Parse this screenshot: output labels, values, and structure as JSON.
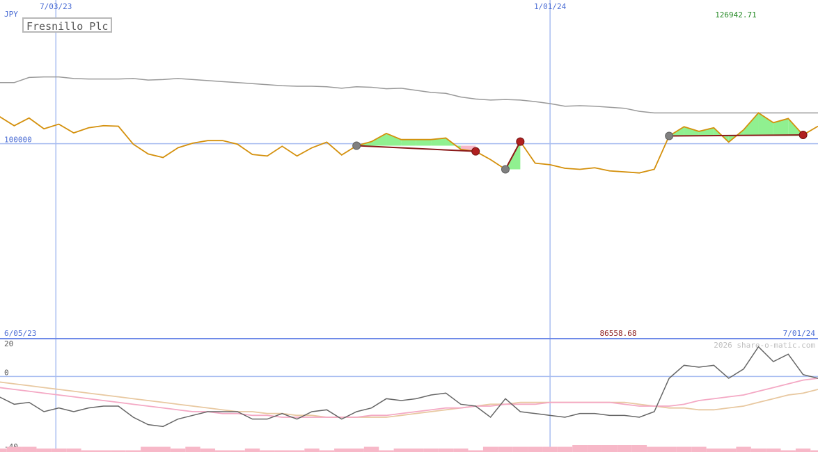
{
  "chart_data": [
    {
      "type": "line",
      "title": "Fresnillo Plc",
      "ylabel": "JPY",
      "x_date_labels": [
        "7/03/23",
        "1/01/24"
      ],
      "date_range": [
        "6/05/23",
        "7/01/24"
      ],
      "max_label": "126942.71",
      "min_label": "86558.68",
      "reference_line": 100000,
      "reference_label": "100000",
      "ylim": [
        62000,
        128000
      ],
      "grid": "vertical month lines",
      "n_points": 56,
      "series": [
        {
          "role": "price",
          "values": [
            105300,
            103500,
            105000,
            102900,
            103800,
            102100,
            103100,
            103500,
            103400,
            99900,
            98000,
            97300,
            99200,
            100100,
            100600,
            100600,
            99900,
            97900,
            97600,
            99500,
            97600,
            99200,
            100300,
            97800,
            99600,
            100400,
            102000,
            100800,
            100800,
            100800,
            101100,
            98900,
            98500,
            96900,
            95000,
            100400,
            96200,
            95900,
            95200,
            95000,
            95300,
            94700,
            94500,
            94300,
            95000,
            101500,
            103300,
            102400,
            103100,
            100300,
            102700,
            106000,
            104100,
            104900,
            101700,
            103400
          ]
        },
        {
          "role": "moving average",
          "values": [
            111900,
            111900,
            112900,
            113000,
            113000,
            112700,
            112600,
            112600,
            112600,
            112700,
            112400,
            112500,
            112700,
            112500,
            112300,
            112100,
            111900,
            111700,
            111500,
            111300,
            111200,
            111200,
            111100,
            110800,
            111100,
            111000,
            110700,
            110800,
            110400,
            110000,
            109800,
            109100,
            108700,
            108500,
            108600,
            108500,
            108200,
            107800,
            107300,
            107400,
            107300,
            107100,
            106900,
            106300,
            106000,
            106000,
            106000,
            106000,
            106000,
            106000,
            106000,
            106000,
            106000,
            106000,
            106000,
            106000
          ]
        }
      ],
      "trades": [
        {
          "start": 24,
          "end": 32,
          "outcome": "loss"
        },
        {
          "start": 34,
          "end": 35,
          "outcome": "loss"
        },
        {
          "start": 45,
          "end": 54,
          "outcome": "loss"
        }
      ]
    },
    {
      "type": "line",
      "title": "",
      "credit": "2026 share-o-matic.com",
      "ylim": [
        -40,
        20
      ],
      "y_ticks": [
        20,
        0,
        -40
      ],
      "tick_labels": [
        "20",
        "0",
        "-40"
      ],
      "n_points": 56,
      "series": [
        {
          "role": "oscillator",
          "values": [
            -11,
            -15,
            -14,
            -19,
            -17,
            -19,
            -17,
            -16,
            -16,
            -22,
            -26,
            -27,
            -23,
            -21,
            -19,
            -19,
            -19,
            -23,
            -23,
            -20,
            -23,
            -19,
            -18,
            -23,
            -19,
            -17,
            -12,
            -13,
            -12,
            -10,
            -9,
            -15,
            -16,
            -22,
            -12,
            -19,
            -20,
            -21,
            -22,
            -20,
            -20,
            -21,
            -21,
            -22,
            -19,
            -1,
            6,
            5,
            6,
            -1,
            4,
            16,
            8,
            12,
            1,
            -1
          ]
        },
        {
          "role": "signal",
          "values": [
            -6,
            -7,
            -8,
            -9,
            -10,
            -11,
            -12,
            -13,
            -14,
            -15,
            -16,
            -17,
            -18,
            -19,
            -19,
            -20,
            -20,
            -21,
            -21,
            -22,
            -22,
            -22,
            -22,
            -22,
            -22,
            -21,
            -21,
            -20,
            -19,
            -18,
            -17,
            -17,
            -16,
            -16,
            -15,
            -15,
            -15,
            -14,
            -14,
            -14,
            -14,
            -14,
            -15,
            -16,
            -16,
            -16,
            -15,
            -13,
            -12,
            -11,
            -10,
            -8,
            -6,
            -4,
            -2,
            -1
          ]
        },
        {
          "role": "trend",
          "values": [
            -3,
            -4,
            -5,
            -6,
            -7,
            -8,
            -9,
            -10,
            -11,
            -12,
            -13,
            -14,
            -15,
            -16,
            -17,
            -18,
            -19,
            -19,
            -20,
            -20,
            -21,
            -21,
            -22,
            -22,
            -22,
            -22,
            -22,
            -21,
            -20,
            -19,
            -18,
            -17,
            -16,
            -15,
            -15,
            -14,
            -14,
            -14,
            -14,
            -14,
            -14,
            -14,
            -14,
            -15,
            -16,
            -17,
            -17,
            -18,
            -18,
            -17,
            -16,
            -14,
            -12,
            -10,
            -9,
            -7
          ]
        }
      ],
      "histogram": [
        2,
        3,
        3,
        2,
        2,
        2,
        1,
        1,
        1,
        1,
        3,
        3,
        2,
        3,
        2,
        1,
        1,
        2,
        1,
        1,
        1,
        2,
        1,
        2,
        2,
        3,
        1,
        2,
        2,
        2,
        2,
        2,
        1,
        3,
        3,
        3,
        3,
        3,
        3,
        4,
        4,
        4,
        4,
        4,
        3,
        3,
        3,
        3,
        2,
        2,
        3,
        2,
        2,
        1,
        2,
        1
      ]
    }
  ]
}
